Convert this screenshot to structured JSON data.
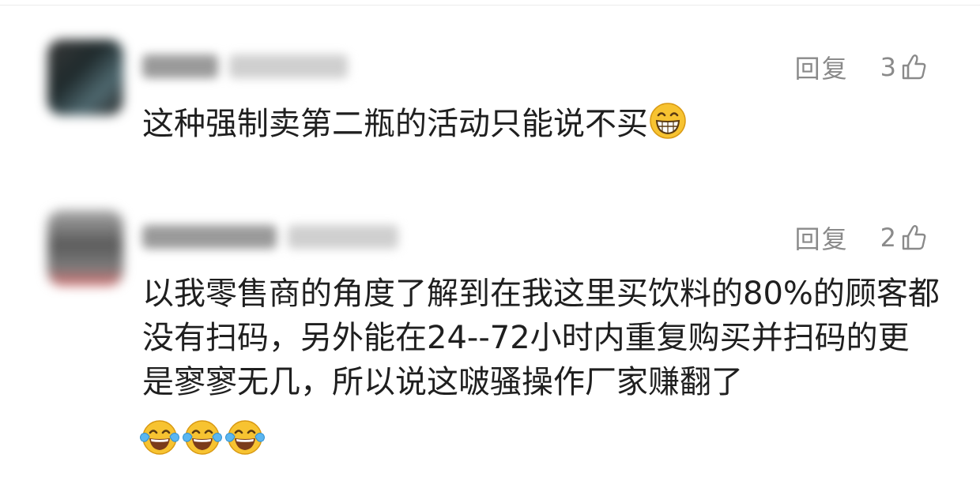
{
  "comments": [
    {
      "reply_label": "回复",
      "like_count": "3",
      "text": "这种强制卖第二瓶的活动只能说不买",
      "trailing_emoji": "grinning-face"
    },
    {
      "reply_label": "回复",
      "like_count": "2",
      "text": "以我零售商的角度了解到在我这里买饮料的80%的顾客都没有扫码，另外能在24--72小时内重复购买并扫码的更是寥寥无几，所以说这啵骚操作厂家赚翻了",
      "trailing_emojis": [
        "tears-of-joy-face",
        "tears-of-joy-face",
        "tears-of-joy-face"
      ]
    }
  ],
  "icons": {
    "like": "thumbs-up-outline-icon",
    "reply": "text-button"
  },
  "colors": {
    "action_gray": "#8a8a8a",
    "text": "#1f1f1f",
    "emoji_yellow": "#f7c331"
  }
}
